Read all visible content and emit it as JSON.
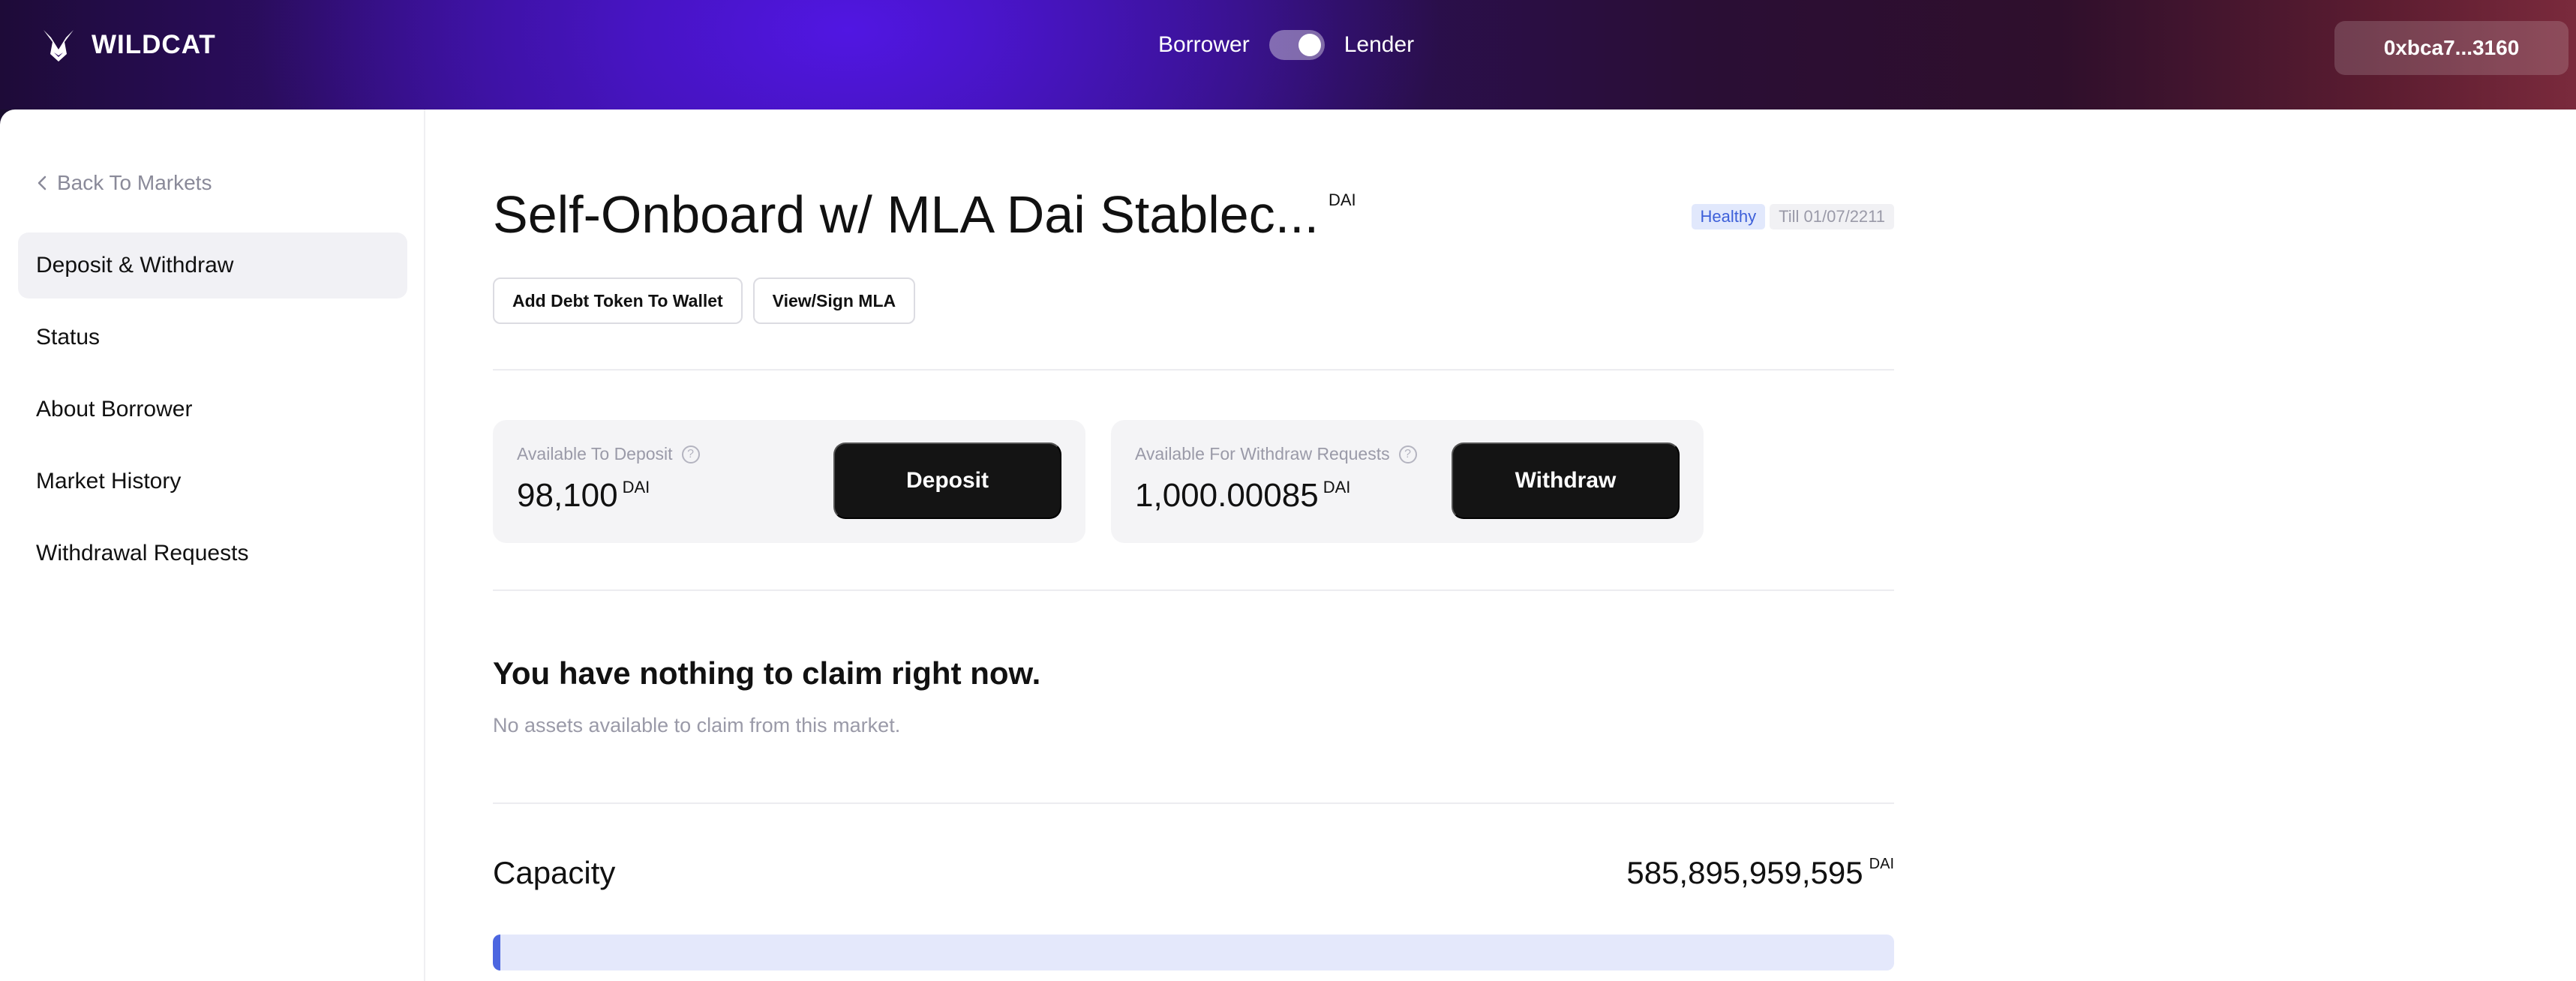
{
  "header": {
    "logo_text": "WILDCAT",
    "borrower_label": "Borrower",
    "lender_label": "Lender",
    "toggle_state": "lender",
    "wallet_address": "0xbca7...3160"
  },
  "sidebar": {
    "back_label": "Back To Markets",
    "items": [
      {
        "label": "Deposit & Withdraw",
        "active": true
      },
      {
        "label": "Status",
        "active": false
      },
      {
        "label": "About Borrower",
        "active": false
      },
      {
        "label": "Market History",
        "active": false
      },
      {
        "label": "Withdrawal Requests",
        "active": false
      }
    ]
  },
  "market": {
    "title": "Self-Onboard w/ MLA Dai Stablec...",
    "asset": "DAI",
    "health_badge": "Healthy",
    "till_badge": "Till 01/07/2211",
    "add_token_label": "Add Debt Token To Wallet",
    "view_mla_label": "View/Sign MLA"
  },
  "deposit_card": {
    "label": "Available To Deposit",
    "amount": "98,100",
    "unit": "DAI",
    "button_label": "Deposit"
  },
  "withdraw_card": {
    "label": "Available For Withdraw Requests",
    "amount": "1,000.00085",
    "unit": "DAI",
    "button_label": "Withdraw"
  },
  "claim": {
    "title": "You have nothing to claim right now.",
    "subtitle": "No assets available to claim from this market."
  },
  "capacity": {
    "label": "Capacity",
    "value": "585,895,959,595",
    "unit": "DAI",
    "fill_percent": 0.5
  },
  "colors": {
    "accent": "#4c66e0",
    "healthy_bg": "#e1e8fc",
    "healthy_text": "#3d5fd9",
    "button_dark": "#141414"
  }
}
